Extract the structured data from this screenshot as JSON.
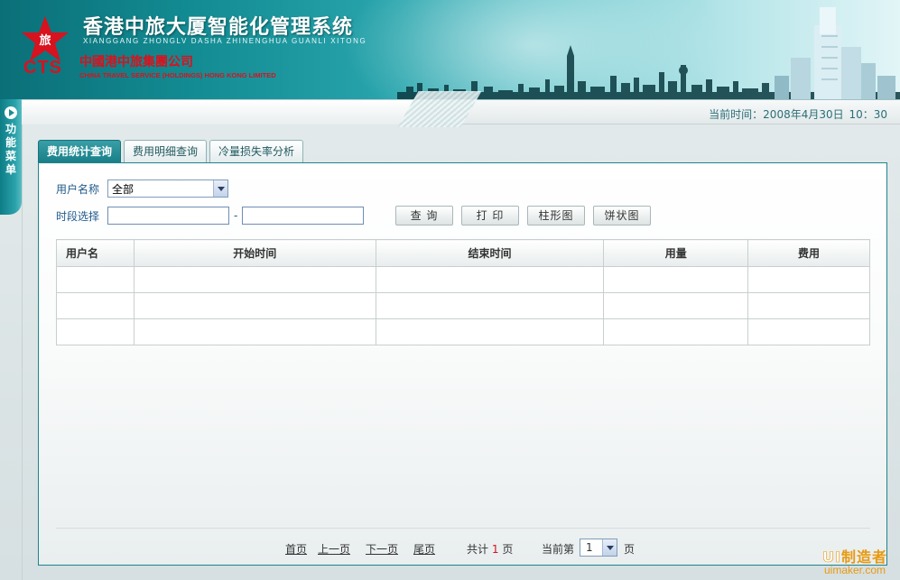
{
  "header": {
    "system_title": "香港中旅大厦智能化管理系统",
    "system_pinyin": "XIANGGANG ZHONGLV DASHA ZHINENGHUA GUANLI XITONG",
    "logo_text": "CTS",
    "logo_star_char": "旅",
    "company_cn": "中國港中旅集團公司",
    "company_en": "CHINA TRAVEL SERVICE (HOLDINGS) HONG KONG LIMITED"
  },
  "time_bar": {
    "label": "当前时间：",
    "date": "2008年4月30日",
    "time": "10：30"
  },
  "side_menu": {
    "label_chars": [
      "功",
      "能",
      "菜",
      "单"
    ]
  },
  "tabs": [
    {
      "label": "费用统计查询",
      "active": true
    },
    {
      "label": "费用明细查询",
      "active": false
    },
    {
      "label": "冷量损失率分析",
      "active": false
    }
  ],
  "form": {
    "user_label": "用户名称",
    "user_value": "全部",
    "period_label": "时段选择",
    "start_value": "",
    "end_value": "",
    "range_separator": "-"
  },
  "buttons": {
    "query": "查  询",
    "print": "打  印",
    "bar_chart": "柱形图",
    "pie_chart": "饼状图"
  },
  "table": {
    "headers": [
      "用户名",
      "开始时间",
      "结束时间",
      "用量",
      "费用"
    ],
    "rows": [
      [
        "",
        "",
        "",
        "",
        ""
      ],
      [
        "",
        "",
        "",
        "",
        ""
      ],
      [
        "",
        "",
        "",
        "",
        ""
      ]
    ]
  },
  "pager": {
    "first": "首页",
    "prev": "上一页",
    "next": "下一页",
    "last": "尾页",
    "total_prefix": "共计",
    "total_pages": "1",
    "total_suffix": "页",
    "current_prefix": "当前第",
    "current_page": "1",
    "current_suffix": "页"
  },
  "watermark": {
    "line1_ui": "UI",
    "line1_rest": "制造者",
    "line2": "uimaker.com"
  },
  "colors": {
    "accent": "#1a8d95",
    "header_dark": "#0b6f78",
    "logo_red": "#d8121e",
    "label_blue": "#1f5a8a"
  }
}
